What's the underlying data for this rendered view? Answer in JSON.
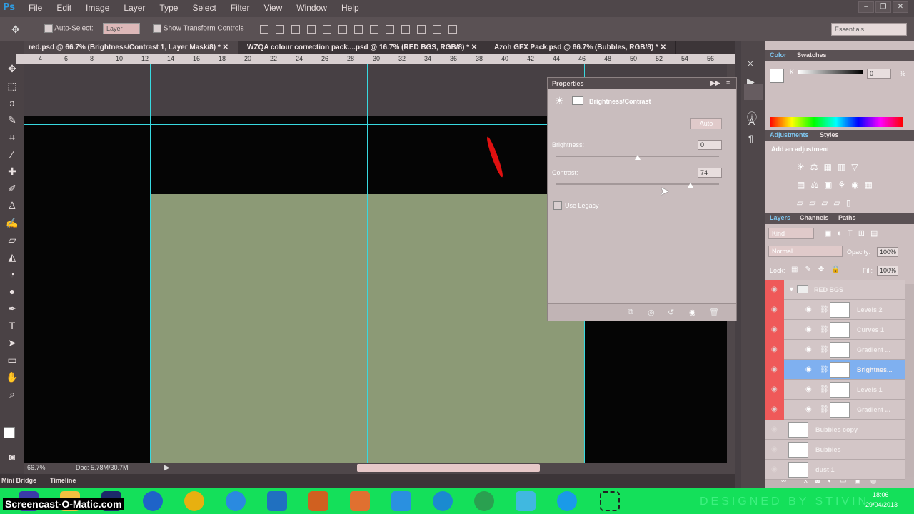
{
  "app": {
    "logo": "Ps"
  },
  "menu": [
    "File",
    "Edit",
    "Image",
    "Layer",
    "Type",
    "Select",
    "Filter",
    "View",
    "Window",
    "Help"
  ],
  "options": {
    "auto_select": "Auto-Select:",
    "auto_select_value": "Layer",
    "show_transform": "Show Transform Controls",
    "workspace": "Essentials"
  },
  "tabs": [
    {
      "label": "red.psd @ 66.7% (Brightness/Contrast 1, Layer Mask/8) *",
      "active": true
    },
    {
      "label": "WZQA colour correction pack....psd @ 16.7% (RED BGS, RGB/8) *",
      "active": false
    },
    {
      "label": "Azoh GFX Pack.psd @ 66.7% (Bubbles, RGB/8) *",
      "active": false
    }
  ],
  "ruler": [
    "4",
    "6",
    "8",
    "10",
    "12",
    "14",
    "16",
    "18",
    "20",
    "22",
    "24",
    "26",
    "28",
    "30",
    "32",
    "34",
    "36",
    "38",
    "40",
    "42",
    "44",
    "46",
    "48",
    "50",
    "52",
    "54",
    "56"
  ],
  "status": {
    "zoom": "66.7%",
    "doc": "Doc: 5.78M/30.7M",
    "mini_bridge": "Mini Bridge",
    "timeline": "Timeline"
  },
  "properties": {
    "title": "Properties",
    "adjustment": "Brightness/Contrast",
    "auto": "Auto",
    "brightness_label": "Brightness:",
    "brightness_value": "0",
    "brightness": 0,
    "contrast_label": "Contrast:",
    "contrast_value": "74",
    "contrast": 74,
    "legacy": "Use Legacy"
  },
  "color_panel": {
    "tabs": [
      "Color",
      "Swatches"
    ],
    "k_label": "K",
    "k_value": "0",
    "k_unit": "%"
  },
  "adjustments_panel": {
    "tabs": [
      "Adjustments",
      "Styles"
    ],
    "add_label": "Add an adjustment"
  },
  "layers_panel": {
    "tabs": [
      "Layers",
      "Channels",
      "Paths"
    ],
    "kind": "Kind",
    "blend": "Normal",
    "opacity_label": "Opacity:",
    "opacity": "100%",
    "lock_label": "Lock:",
    "fill_label": "Fill:",
    "fill": "100%",
    "group": "RED BGS",
    "layers": [
      {
        "name": "Levels 2",
        "in_group": true,
        "selected": false
      },
      {
        "name": "Curves 1",
        "in_group": true,
        "selected": false
      },
      {
        "name": "Gradient ...",
        "in_group": true,
        "selected": false
      },
      {
        "name": "Brightnes...",
        "in_group": true,
        "selected": true
      },
      {
        "name": "Levels 1",
        "in_group": true,
        "selected": false
      },
      {
        "name": "Gradient ...",
        "in_group": true,
        "selected": false
      },
      {
        "name": "Bubbles copy",
        "in_group": false,
        "selected": false
      },
      {
        "name": "Bubbles",
        "in_group": false,
        "selected": false
      },
      {
        "name": "dust 1",
        "in_group": false,
        "selected": false
      }
    ]
  },
  "taskbar": {
    "time": "18:06",
    "date": "29/04/2013",
    "brand": "DESIGNED BY STIVIN"
  },
  "watermark": "Screencast-O-Matic.com",
  "colors": {
    "guide": "#38d9e0",
    "sage": "#8c9a76",
    "red_group": "#ef5959",
    "selected": "#7fb0f0",
    "taskbar": "#14e05a"
  }
}
